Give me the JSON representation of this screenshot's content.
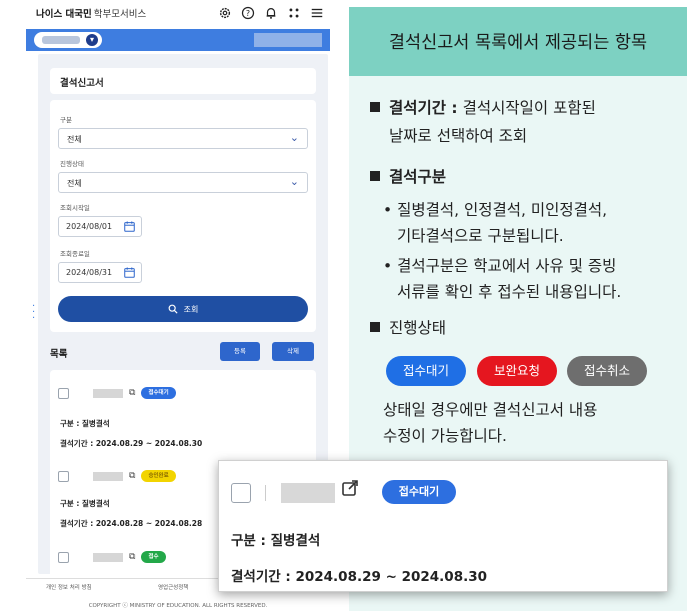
{
  "app": {
    "logo": "나이스 대국민",
    "service": "학부모서비스"
  },
  "title": "결석신고서",
  "filters": {
    "type_label": "구분",
    "type_value": "전체",
    "status_label": "진행상태",
    "status_value": "전체",
    "start_label": "조회시작일",
    "start_value": "2024/08/01",
    "end_label": "조회종료일",
    "end_value": "2024/08/31",
    "search_label": "조회"
  },
  "list": {
    "heading": "목록",
    "register_label": "등록",
    "delete_label": "삭제",
    "items": [
      {
        "badge": "접수대기",
        "type": "구분 : 질병결석",
        "period": "결석기간 : 2024.08.29 ~ 2024.08.30"
      },
      {
        "badge": "승인완료",
        "type": "구분 : 질병결석",
        "period": "결석기간 : 2024.08.28 ~ 2024.08.28"
      },
      {
        "badge": "접수"
      }
    ]
  },
  "footer": {
    "privacy": "개인 정보 처리 방침",
    "policy": "영업근성정책",
    "copyright": "COPYRIGHT ⓒ MINISTRY OF EDUCATION. ALL RIGHTS RESERVED."
  },
  "panel": {
    "header": "결석신고서 목록에서 제공되는 항목",
    "period_title": "결석기간 :",
    "period_desc_1": "결석시작일이 포함된",
    "period_desc_2": "날짜로 선택하여 조회",
    "type_title": "결석구분",
    "type_b1_1": "• 질병결석, 인정결석, 미인정결석,",
    "type_b1_2": "기타결석으로 구분됩니다.",
    "type_b2_1": "• 결석구분은 학교에서 사유 및 증빙",
    "type_b2_2": "서류를 확인 후 접수된 내용입니다.",
    "status_title": "진행상태",
    "badge_wait": "접수대기",
    "badge_fix": "보완요청",
    "badge_cancel": "접수취소",
    "status_desc_1": "상태일 경우에만 결석신고서 내용",
    "status_desc_2": "수정이 가능합니다."
  },
  "zoom": {
    "badge": "접수대기",
    "type": "구분 : 질병결석",
    "period": "결석기간 : 2024.08.29 ~ 2024.08.30"
  },
  "colors": {
    "brand_blue": "#3e7de0",
    "dark_blue": "#1f4fa3",
    "teal_header": "#7dd1c2",
    "panel_bg": "#eaf7f5",
    "badge_blue": "#1f6fe5",
    "badge_red": "#e5161f",
    "badge_gray": "#6e6e6e",
    "badge_yellow": "#f2d400",
    "badge_green": "#23a849"
  },
  "icons": [
    "gear-icon",
    "help-icon",
    "bell-icon",
    "apps-icon",
    "menu-icon",
    "calendar-icon",
    "search-icon",
    "external-link-icon",
    "chevron-down-icon"
  ]
}
